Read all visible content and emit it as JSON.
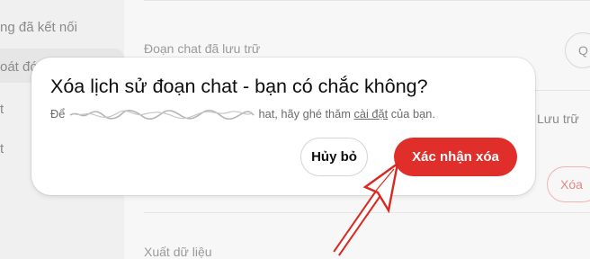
{
  "sidebar": {
    "items": [
      {
        "label": "ng đã kết nối"
      },
      {
        "label": "oát đó"
      },
      {
        "label": "t"
      },
      {
        "label": "t"
      }
    ]
  },
  "settings": {
    "archived_label": "Đoạn chat đã lưu trữ",
    "archived_button": "Q",
    "archive_all_button": "Lưu trữ",
    "delete_all_button": "Xóa",
    "export_label": "Xuất dữ liệu"
  },
  "dialog": {
    "title": "Xóa lịch sử đoạn chat - bạn có chắc không?",
    "desc_start": "Để",
    "desc_middle": "hat, hãy ghé thăm",
    "desc_link": "cài đặt",
    "desc_end": "của bạn.",
    "cancel_label": "Hủy bỏ",
    "confirm_label": "Xác nhận xóa"
  },
  "colors": {
    "confirm_bg": "#e02e2a",
    "annotation_arrow": "#d9281f"
  },
  "icons": {
    "annotation": "red-arrow-icon"
  }
}
